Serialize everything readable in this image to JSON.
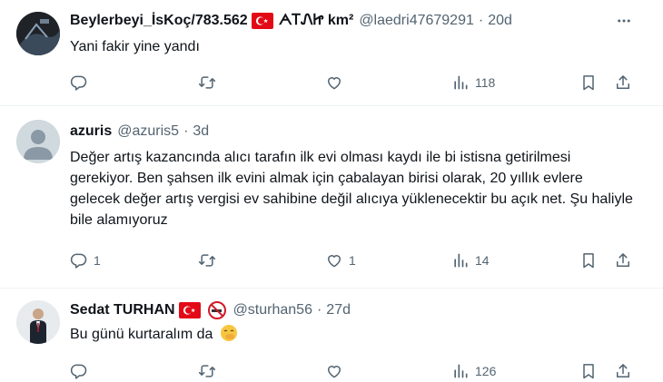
{
  "colors": {
    "text": "#0f1419",
    "muted": "#536471",
    "divider": "#eff3f4",
    "flag_red": "#e30a17"
  },
  "tweets": [
    {
      "display_name": "Beylerbeyi_İsKoç/783.562",
      "name_extra": "ᗅᎢᏁᏥ km²",
      "handle": "@laedri47679291",
      "time": "20d",
      "text": "Yani fakir yine yandı",
      "counts": {
        "reply": "",
        "retweet": "",
        "like": "",
        "views": "118"
      }
    },
    {
      "display_name": "azuris",
      "handle": "@azuris5",
      "time": "3d",
      "text": "Değer artış kazancında alıcı tarafın ilk evi olması kaydı ile bi istisna getirilmesi gerekiyor. Ben şahsen ilk evini almak için çabalayan birisi olarak, 20 yıllık evlere gelecek değer artış vergisi ev sahibine değil alıcıya yüklenecektir bu açık net. Şu haliyle bile alamıyoruz",
      "counts": {
        "reply": "1",
        "retweet": "",
        "like": "1",
        "views": "14"
      }
    },
    {
      "display_name": "Sedat TURHAN",
      "handle": "@sturhan56",
      "time": "27d",
      "text": "Bu günü kurtaralım da",
      "counts": {
        "reply": "",
        "retweet": "",
        "like": "",
        "views": "126"
      }
    }
  ],
  "icons": {
    "more": "more-horizontal-icon",
    "reply": "reply-icon",
    "retweet": "retweet-icon",
    "like": "heart-icon",
    "views": "views-chart-icon",
    "bookmark": "bookmark-icon",
    "share": "share-icon",
    "flag": "turkey-flag-icon",
    "no_smoking": "no-smoking-icon",
    "emoji": "smiling-face-with-hand-over-mouth-emoji"
  }
}
